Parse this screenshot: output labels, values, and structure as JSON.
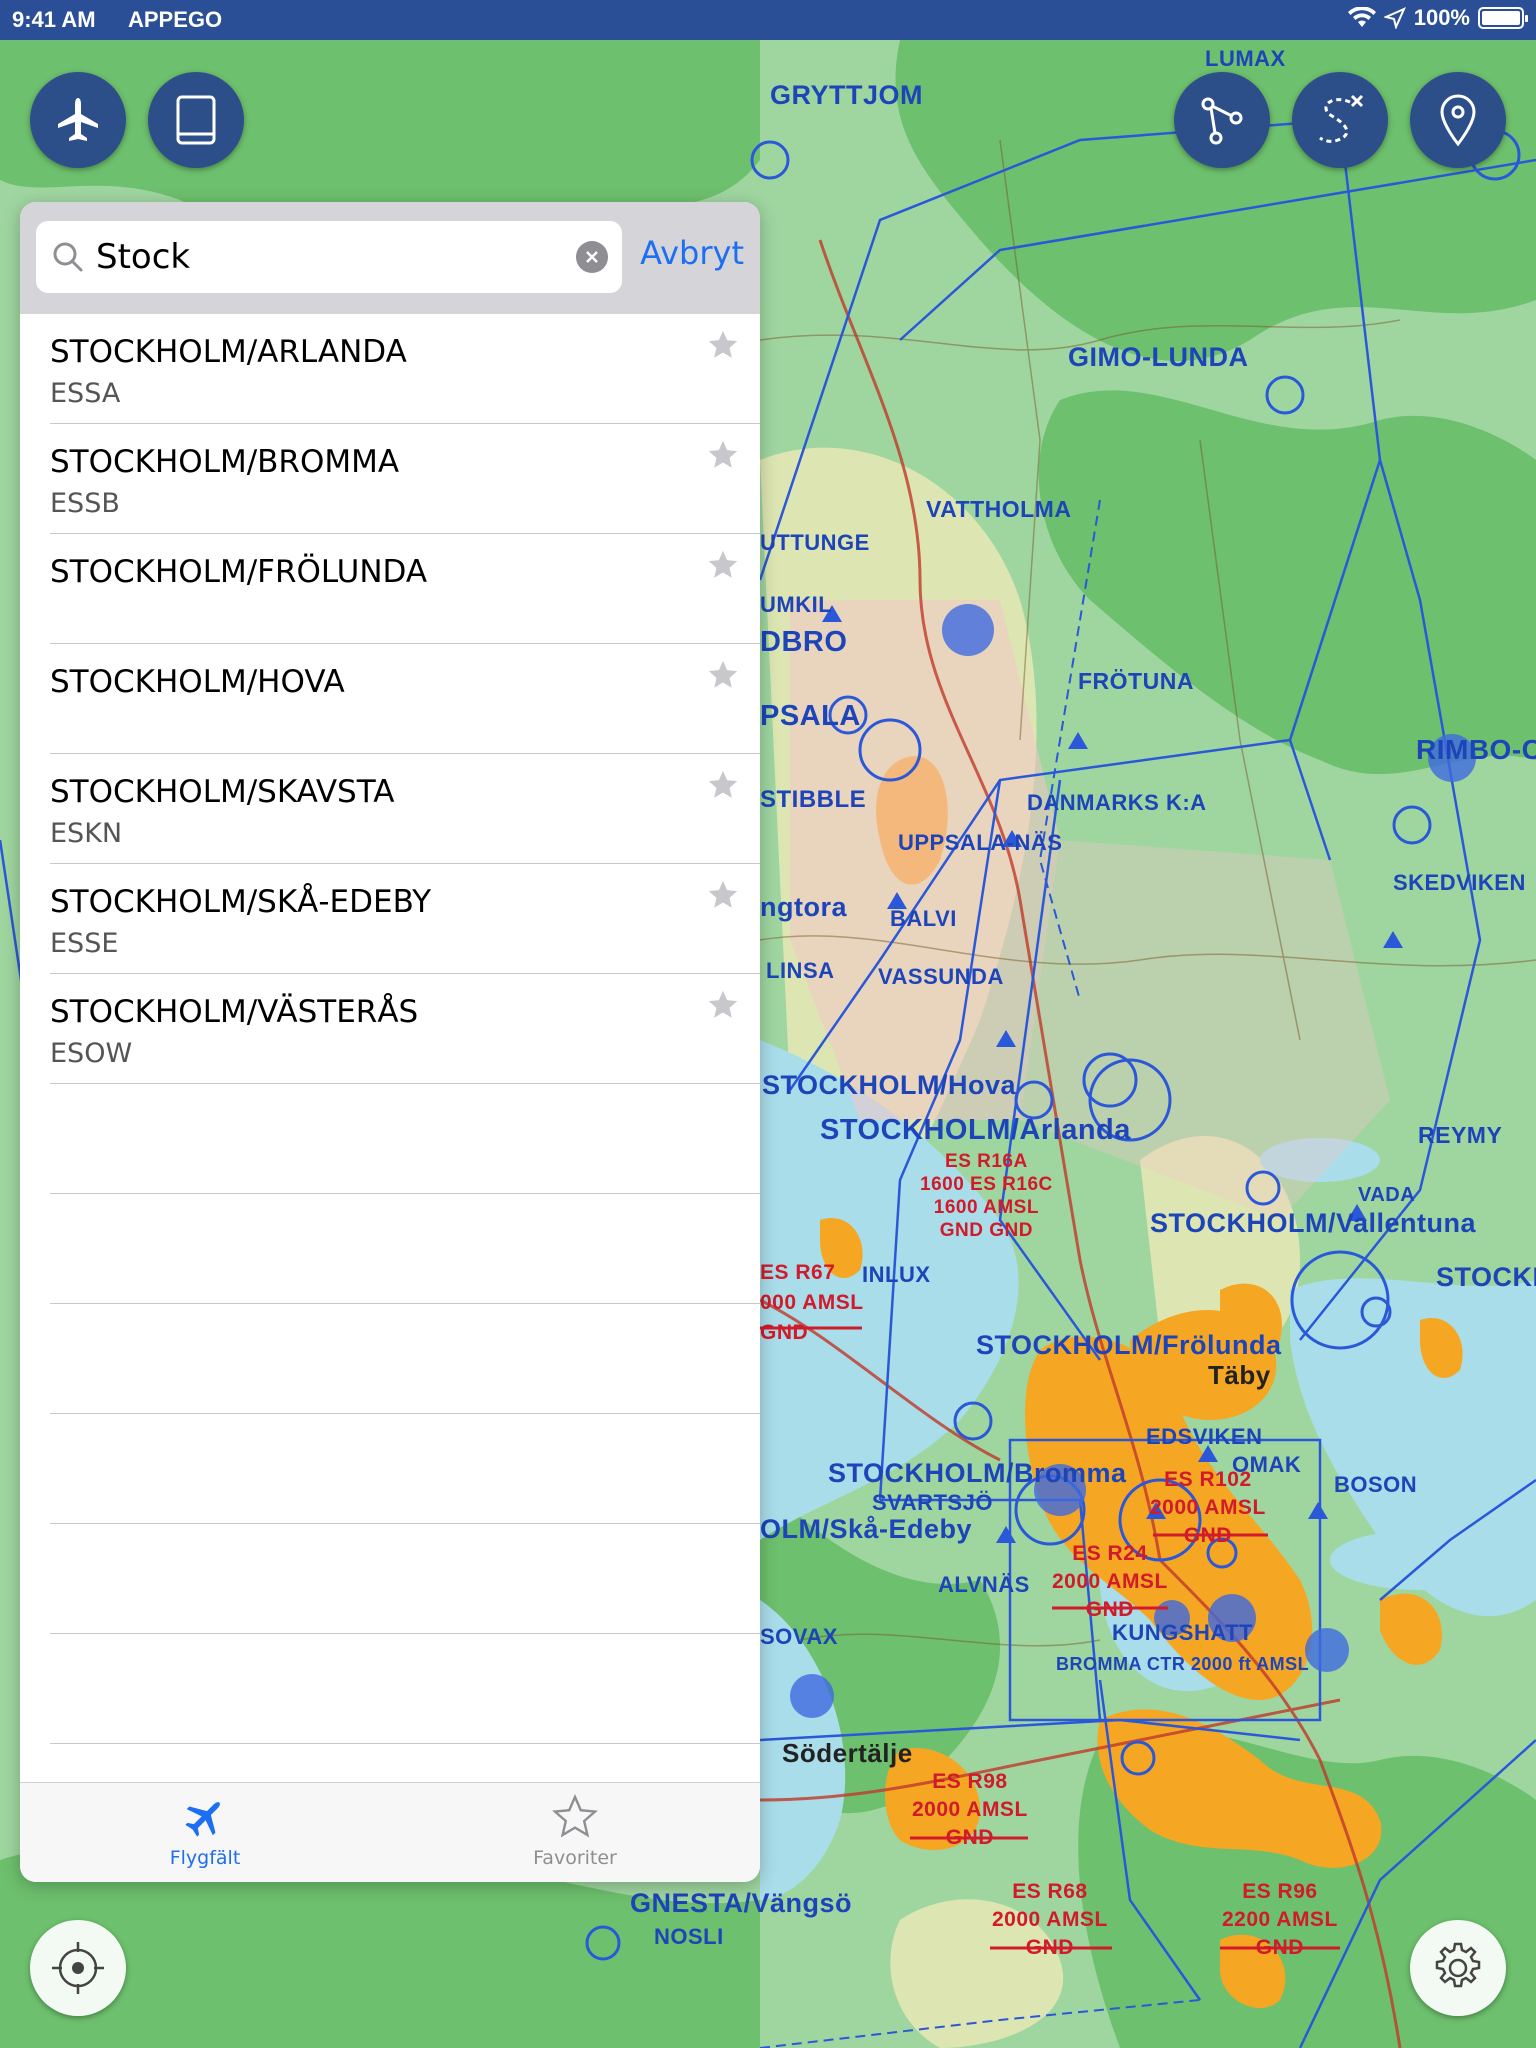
{
  "status_bar": {
    "time": "9:41 AM",
    "carrier": "APPEGO",
    "battery_percent": "100%"
  },
  "top_buttons": {
    "left": [
      "airplane-icon",
      "book-icon"
    ],
    "right": [
      "route-icon",
      "curve-route-icon",
      "location-pin-icon"
    ]
  },
  "search": {
    "query": "Stock",
    "cancel_label": "Avbryt"
  },
  "results": [
    {
      "name": "STOCKHOLM/ARLANDA",
      "code": "ESSA"
    },
    {
      "name": "STOCKHOLM/BROMMA",
      "code": "ESSB"
    },
    {
      "name": "STOCKHOLM/FRÖLUNDA",
      "code": ""
    },
    {
      "name": "STOCKHOLM/HOVA",
      "code": ""
    },
    {
      "name": "STOCKHOLM/SKAVSTA",
      "code": "ESKN"
    },
    {
      "name": "STOCKHOLM/SKÅ-EDEBY",
      "code": "ESSE"
    },
    {
      "name": "STOCKHOLM/VÄSTERÅS",
      "code": "ESOW"
    }
  ],
  "tabs": [
    {
      "label": "Flygfält",
      "icon": "airplane-icon",
      "active": true
    },
    {
      "label": "Favoriter",
      "icon": "star-icon",
      "active": false
    }
  ],
  "map": {
    "labels_blue": [
      {
        "text": "GRYTTJOM"
      },
      {
        "text": "LUMAX"
      },
      {
        "text": "GIMO-LUNDA"
      },
      {
        "text": "VATTHOLMA"
      },
      {
        "text": "FRÖTUNA"
      },
      {
        "text": "RIMBO-C"
      },
      {
        "text": "DANMARKS K:A"
      },
      {
        "text": "UPPSALA-NÄS"
      },
      {
        "text": "SKEDVIKEN"
      },
      {
        "text": "BALVI"
      },
      {
        "text": "VASSUNDA"
      },
      {
        "text": "STOCKHOLM/Hova"
      },
      {
        "text": "STOCKHOLM/Arlanda"
      },
      {
        "text": "REYMY"
      },
      {
        "text": "VADA"
      },
      {
        "text": "STOCKHOLM/Vallentuna"
      },
      {
        "text": "INLUX"
      },
      {
        "text": "STOCKHOLM/Frölunda"
      },
      {
        "text": "EDSVIKEN"
      },
      {
        "text": "STOCKHOLM/Bromma"
      },
      {
        "text": "BOSON"
      },
      {
        "text": "SVARTSJÖ"
      },
      {
        "text": "OLM/Skå-Edeby"
      },
      {
        "text": "ALVNÄS"
      },
      {
        "text": "KUNGSHATT"
      },
      {
        "text": "BROMMA CTR 2000 ft AMSL"
      },
      {
        "text": "SOVAX"
      },
      {
        "text": "GNESTA/Vängsö"
      },
      {
        "text": "NOSLI"
      },
      {
        "text": "PSALA"
      },
      {
        "text": "DBRO"
      },
      {
        "text": "STIBBLE"
      },
      {
        "text": "LINSA"
      },
      {
        "text": "ngtora"
      },
      {
        "text": "UTTUNGE"
      },
      {
        "text": "UMKIL"
      },
      {
        "text": "OMAK"
      },
      {
        "text": "STOCKH"
      }
    ],
    "labels_red": [
      {
        "text": "ES R102\n2000 AMSL\nGND"
      },
      {
        "text": "ES R24\n2000 AMSL\nGND"
      },
      {
        "text": "ES R98\n2000 AMSL\nGND"
      },
      {
        "text": "ES R68\n2000 AMSL\nGND"
      },
      {
        "text": "ES R96\n2200 AMSL\nGND"
      },
      {
        "text": "ES R67\n000 AMSL\nGND"
      },
      {
        "text": "ES R16A\n1600 ES R16C\n1600 AMSL\nGND GND"
      }
    ],
    "labels_dark": [
      {
        "text": "Södertälje"
      },
      {
        "text": "Täby"
      }
    ]
  },
  "colors": {
    "status_bar": "#2a4f96",
    "accent": "#1c6ef2",
    "button_bg": "#2c4f8a",
    "airspace": "#1d44b8",
    "restricted": "#d11a2a",
    "urban": "#f5a623"
  }
}
